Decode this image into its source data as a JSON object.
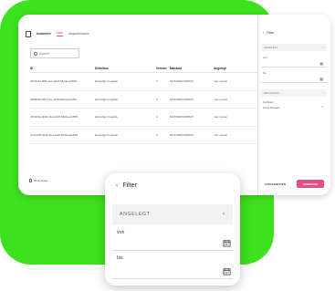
{
  "header": {
    "app_title": "Instanzen",
    "tabs": [
      "Aktiv",
      "Abgeschlossen"
    ]
  },
  "search": {
    "placeholder": "Suchen"
  },
  "table": {
    "columns": [
      "ID",
      "Definition",
      "Version",
      "Mandant",
      "Angelegt"
    ],
    "rows": [
      [
        "33f43c5a-9f56-11ef-a0c8-562deeeb55f4",
        "Einstufige Freigabe",
        "2",
        "MUSTERKOMPANY",
        "max muster"
      ],
      [
        "2f0f8049-9f56-11ef-a0c8-562deeeb55f4",
        "Einstufige Freigabe",
        "2",
        "MUSTERKOMPANY",
        "max muster"
      ],
      [
        "33f43c5a-9b94-11ef-a0c8-562deeeb55f4",
        "Einstufige Freigabe",
        "2",
        "MUSTERKOMPANY",
        "max muster"
      ],
      [
        "a7dc125b-9b4f-11ef-a0c8-562deeeb55f4",
        "Einstufige Freigabe",
        "2",
        "MUSTERKOMPANY",
        "max muster"
      ]
    ]
  },
  "footer": {
    "count_label": "35 Einträge"
  },
  "filter_side": {
    "title": "Filter",
    "section_angelegt": "ANGELEGT",
    "label_von": "von",
    "label_bis": "bis",
    "section_definition": "DEFINITION",
    "label_definition": "Definition",
    "select_value": "Keine Auswahl",
    "reset_label": "ZURÜCKSETZEN",
    "apply_label": "ANWENDEN"
  },
  "filter_card": {
    "title": "Filter",
    "section": "ANGELEGT",
    "label_von": "von",
    "label_bis": "bis"
  },
  "colors": {
    "green": "#3ee11e",
    "accent": "#e84d8a"
  }
}
